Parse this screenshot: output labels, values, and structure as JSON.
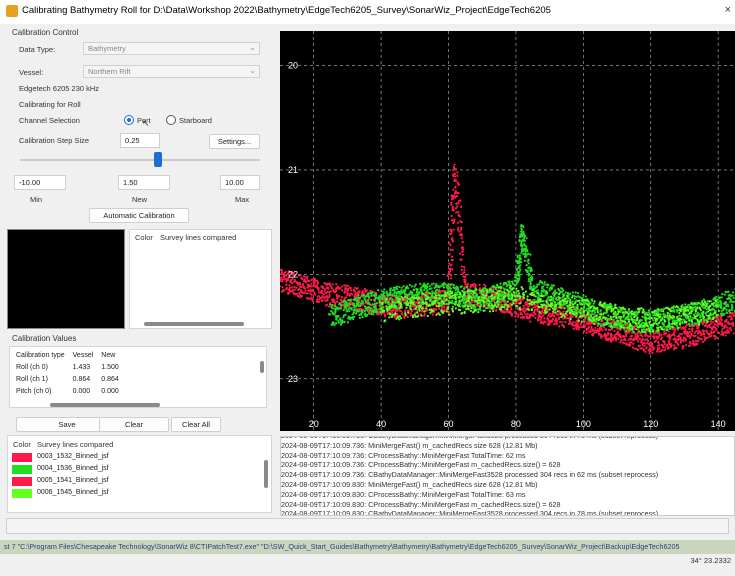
{
  "window": {
    "title": "Calibrating Bathymetry Roll for D:\\Data\\Workshop 2022\\Bathymetry\\EdgeTech6205_Survey\\SonarWiz_Project\\EdgeTech6205",
    "close_glyph": "×"
  },
  "calibration_control": {
    "section_title": "Calibration Control",
    "data_type_label": "Data Type:",
    "data_type_value": "Bathymetry",
    "vessel_label": "Vessel:",
    "vessel_value": "Northern Rift",
    "sonar_label": "Edgetech 6205 230 kHz",
    "calibrating_for": "Calibrating for Roll",
    "channel_label": "Channel Selection",
    "channel_options": [
      "Port",
      "Starboard"
    ],
    "channel_selected": "Port",
    "step_label": "Calibration Step Size",
    "step_value": "0.25",
    "settings_button": "Settings...",
    "slider_min": "-10.00",
    "slider_new": "1.50",
    "slider_max": "10.00",
    "slider_fraction": 0.575,
    "min_label": "Min",
    "new_label": "New",
    "max_label": "Max",
    "auto_button": "Automatic Calibration"
  },
  "preview_list": {
    "color_header": "Color",
    "lines_header": "Survey lines compared"
  },
  "calibration_values": {
    "section_title": "Calibration Values",
    "headers": [
      "Calibration type",
      "Vessel",
      "New"
    ],
    "rows": [
      [
        "Roll (ch 0)",
        "1.433",
        "1.500"
      ],
      [
        "Roll (ch 1)",
        "0.864",
        "0.864"
      ],
      [
        "Pitch (ch 0)",
        "0.000",
        "0.000"
      ]
    ],
    "save_button": "Save",
    "clear_button": "Clear",
    "clear_all_button": "Clear All"
  },
  "survey_lines": {
    "color_header": "Color",
    "lines_header": "Survey lines compared",
    "items": [
      {
        "name": "0003_1532_Binned_jsf",
        "color": "#ff1a4b"
      },
      {
        "name": "0004_1536_Binned_jsf",
        "color": "#22dd22"
      },
      {
        "name": "0005_1541_Binned_jsf",
        "color": "#ff1a4b"
      },
      {
        "name": "0006_1545_Binned_jsf",
        "color": "#66ff22"
      }
    ]
  },
  "chart_data": {
    "type": "scatter",
    "background": "#000000",
    "x_ticks": [
      "20",
      "40",
      "60",
      "80",
      "100",
      "120",
      "140"
    ],
    "y_ticks": [
      "20",
      "21",
      "22",
      "23"
    ],
    "xlim": [
      10,
      145
    ],
    "ylim": [
      19.67,
      23.5
    ],
    "y_inverted": true,
    "grid": true,
    "series": [
      {
        "color": "#ff1a4b",
        "x": [
          10,
          15,
          20,
          25,
          30,
          35,
          40,
          45,
          50,
          55,
          60,
          62,
          65,
          70,
          75,
          80,
          85,
          90,
          95,
          100,
          105,
          110,
          115,
          120,
          125,
          130,
          135,
          140,
          145
        ],
        "y": [
          22.05,
          22.1,
          22.15,
          22.2,
          22.22,
          22.25,
          22.3,
          22.32,
          22.3,
          22.28,
          22.25,
          21.0,
          22.2,
          22.2,
          22.25,
          22.3,
          22.35,
          22.38,
          22.4,
          22.45,
          22.5,
          22.55,
          22.6,
          22.65,
          22.62,
          22.6,
          22.55,
          22.5,
          22.45
        ]
      },
      {
        "color": "#22dd22",
        "x": [
          25,
          30,
          35,
          40,
          45,
          50,
          55,
          60,
          65,
          70,
          75,
          80,
          82,
          85,
          90,
          95,
          100,
          105,
          110,
          115,
          120,
          125,
          130,
          135,
          140,
          145
        ],
        "y": [
          22.4,
          22.35,
          22.3,
          22.25,
          22.22,
          22.2,
          22.18,
          22.2,
          22.22,
          22.25,
          22.2,
          22.15,
          21.6,
          22.15,
          22.2,
          22.25,
          22.3,
          22.38,
          22.42,
          22.45,
          22.45,
          22.42,
          22.4,
          22.35,
          22.3,
          22.25
        ]
      },
      {
        "color": "#66ff22",
        "x": [
          40,
          50,
          60,
          70,
          80,
          90,
          100,
          110,
          120,
          130,
          140
        ],
        "y": [
          22.35,
          22.3,
          22.28,
          22.25,
          22.22,
          22.28,
          22.35,
          22.4,
          22.45,
          22.4,
          22.35
        ]
      }
    ]
  },
  "log": {
    "lines": [
      "2024-08-09T17:10:09.736: CBathyDataManager::MiniMergeFast3528 processed 304 recs in 78 ms (subset reprocess)",
      "2024-08-09T17:10:09.736: MiniMergeFast() m_cachedRecs size 628 (12.81 Mb)",
      "2024-08-09T17:10:09.736: CProcessBathy::MiniMergeFast TotalTime: 62 ms",
      "2024-08-09T17:10:09.736: CProcessBathy::MiniMergeFast m_cachedRecs.size() = 628",
      "2024-08-09T17:10:09.736: CBathyDataManager::MiniMergeFast3528 processed 304 recs in 62 ms (subset reprocess)",
      "2024-08-09T17:10:09.830: MiniMergeFast() m_cachedRecs size 628 (12.81 Mb)",
      "2024-08-09T17:10:09.830: CProcessBathy::MiniMergeFast TotalTime: 63 ms",
      "2024-08-09T17:10:09.830: CProcessBathy::MiniMergeFast m_cachedRecs.size() = 628",
      "2024-08-09T17:10:09.830: CBathyDataManager::MiniMergeFast3528 processed 304 recs in 78 ms (subset reprocess)"
    ]
  },
  "command_line": "st 7 \"C:\\Program Files\\Chesapeake Technology\\SonarWiz 8\\CTIPatchTest7.exe\" \"D:\\SW_Quick_Start_Guides\\Bathymetry\\Bathymetry\\Bathymetry\\EdgeTech6205_Survey\\SonarWiz_Project\\Backup\\EdgeTech6205",
  "coordinates_readout": "34° 23.2332"
}
